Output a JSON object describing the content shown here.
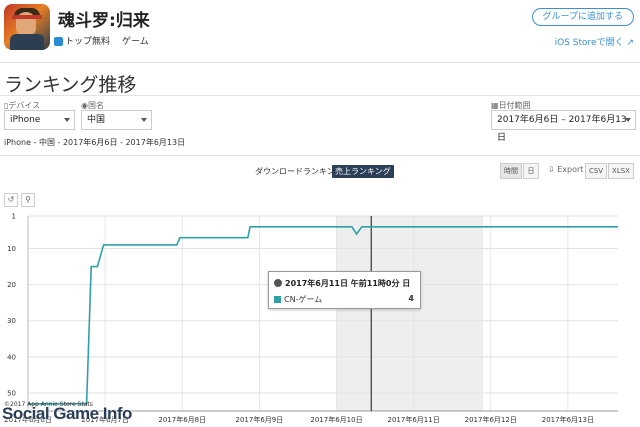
{
  "app": {
    "title": "魂斗罗:归来",
    "category_rank_label": "トップ無料",
    "genre_label": "ゲーム",
    "group_button": "グループに追加する",
    "ios_store_link": "iOS Storeで開く"
  },
  "page": {
    "title": "ランキング推移"
  },
  "filters": {
    "device_label": "デバイス",
    "device_value": "iPhone",
    "country_label": "国名",
    "country_value": "中国",
    "date_range_label": "日付範囲",
    "date_range_value": "2017年6月6日 – 2017年6月13日"
  },
  "summary": "iPhone - 中国 - 2017年6月6日 - 2017年6月13日",
  "tabs": {
    "download_ranking": "ダウンロードランキング",
    "sales_ranking": "売上ランキング"
  },
  "controls": {
    "hourly": "時間",
    "daily": "日",
    "export": "Export",
    "csv": "CSV",
    "xlsx": "XLSX"
  },
  "tooltip": {
    "date": "2017年6月11日 午前11時0分 日",
    "series": "CN-ゲーム",
    "value": "4"
  },
  "credits": "©2017 App Annie Store Stats",
  "watermark": "Social Game Info",
  "colors": {
    "line": "#2fa0a8",
    "active_tab": "#2b3f56",
    "link": "#3a8fd0",
    "weekend_band": "#eeeeee"
  },
  "chart_data": {
    "type": "line",
    "title": "",
    "xlabel": "",
    "ylabel": "",
    "y_reversed": true,
    "ylim": [
      1,
      55
    ],
    "y_ticks": [
      1,
      10,
      20,
      30,
      40,
      50
    ],
    "x_tick_labels": [
      "2017年6月6日",
      "2017年6月7日",
      "2017年6月8日",
      "2017年6月9日",
      "2017年6月10日",
      "2017年6月11日",
      "2017年6月12日",
      "2017年6月13日"
    ],
    "x_range_days": [
      0,
      7.65
    ],
    "weekend_band_days": [
      4.0,
      5.9
    ],
    "crosshair_day": 4.45,
    "series": [
      {
        "name": "CN-ゲーム",
        "points": [
          [
            0.0,
            53
          ],
          [
            0.76,
            53
          ],
          [
            0.82,
            15
          ],
          [
            0.9,
            15
          ],
          [
            0.98,
            9
          ],
          [
            1.93,
            9
          ],
          [
            1.97,
            7
          ],
          [
            2.85,
            7
          ],
          [
            2.88,
            4
          ],
          [
            3.98,
            4
          ],
          [
            4.2,
            4
          ],
          [
            4.26,
            6
          ],
          [
            4.33,
            4
          ],
          [
            7.65,
            4
          ]
        ]
      }
    ]
  }
}
